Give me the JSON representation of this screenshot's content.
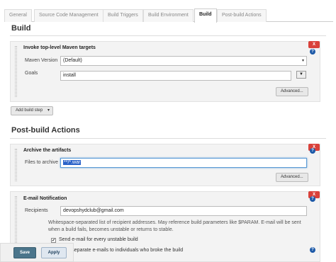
{
  "tabs": [
    "General",
    "Source Code Management",
    "Build Triggers",
    "Build Environment",
    "Build",
    "Post-build Actions"
  ],
  "active_tab": "Build",
  "build": {
    "title": "Build",
    "step": {
      "title": "Invoke top-level Maven targets",
      "delete_label": "X",
      "maven_version_label": "Maven Version",
      "maven_version_value": "(Default)",
      "goals_label": "Goals",
      "goals_value": "install",
      "advanced_label": "Advanced..."
    },
    "add_step_label": "Add build step"
  },
  "post_build": {
    "title": "Post-build Actions",
    "archive": {
      "title": "Archive the artifacts",
      "delete_label": "X",
      "files_label": "Files to archive",
      "files_value": "**/*.war",
      "advanced_label": "Advanced..."
    },
    "email": {
      "title": "E-mail Notification",
      "delete_label": "X",
      "recipients_label": "Recipients",
      "recipients_value": "devopshydclub@gmail.com",
      "note": "Whitespace-separated list of recipient addresses. May reference build parameters like $PARAM. E-mail will be sent when a build fails, becomes unstable or returns to stable.",
      "checkbox1_label": "Send e-mail for every unstable build",
      "checkbox1_checked": "✔",
      "checkbox2_label": "Send separate e-mails to individuals who broke the build"
    }
  },
  "footer": {
    "save_label": "Save",
    "apply_label": "Apply"
  },
  "help_glyph": "?",
  "dropdown_glyph": "▾",
  "expand_glyph": "▼"
}
